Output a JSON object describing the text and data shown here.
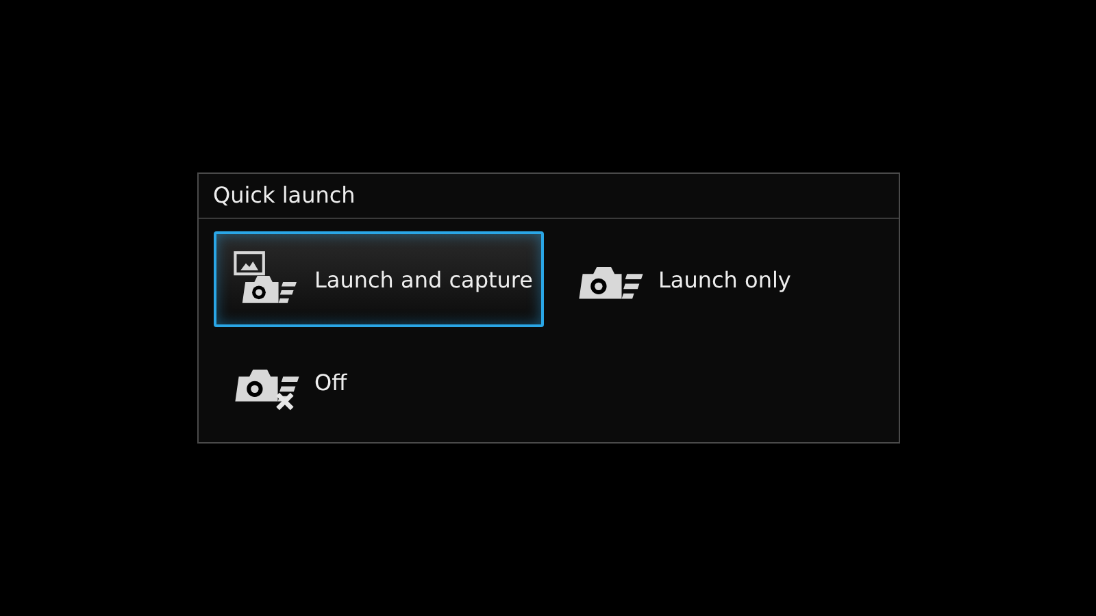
{
  "dialog": {
    "title": "Quick launch"
  },
  "options": [
    {
      "label": "Launch and capture",
      "kind": "capture",
      "selected": true
    },
    {
      "label": "Launch only",
      "kind": "launch",
      "selected": false
    },
    {
      "label": "Off",
      "kind": "off",
      "selected": false
    }
  ]
}
